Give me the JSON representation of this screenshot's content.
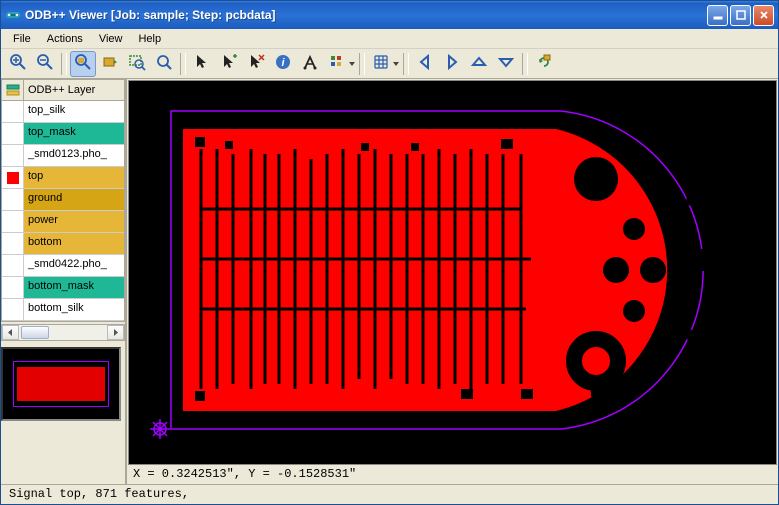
{
  "window": {
    "title": "ODB++ Viewer [Job: sample; Step: pcbdata]"
  },
  "menu": {
    "items": [
      "File",
      "Actions",
      "View",
      "Help"
    ]
  },
  "toolbar": {
    "groups": [
      [
        {
          "name": "zoom-in-icon",
          "tip": "Zoom In"
        },
        {
          "name": "zoom-out-icon",
          "tip": "Zoom Out"
        }
      ],
      [
        {
          "name": "zoom-home-icon",
          "tip": "Zoom Home",
          "active": true
        },
        {
          "name": "pan-icon",
          "tip": "Pan"
        },
        {
          "name": "zoom-area-icon",
          "tip": "Zoom Area"
        },
        {
          "name": "zoom-fit-icon",
          "tip": "Zoom to Profile"
        }
      ],
      [
        {
          "name": "pointer-icon",
          "tip": "Select"
        },
        {
          "name": "pointer-add-icon",
          "tip": "Highlight"
        },
        {
          "name": "pointer-cross-icon",
          "tip": "Unselect"
        },
        {
          "name": "info-icon",
          "tip": "Feature Info"
        },
        {
          "name": "measure-icon",
          "tip": "Measure"
        },
        {
          "name": "settings-icon",
          "tip": "Options",
          "drop": true
        }
      ],
      [
        {
          "name": "grid-icon",
          "tip": "Grid",
          "drop": true
        }
      ],
      [
        {
          "name": "arrow-left-icon",
          "tip": "Left"
        },
        {
          "name": "arrow-right-icon",
          "tip": "Right"
        },
        {
          "name": "arrow-up-icon",
          "tip": "Up"
        },
        {
          "name": "arrow-down-icon",
          "tip": "Down"
        }
      ],
      [
        {
          "name": "redraw-icon",
          "tip": "Redraw"
        }
      ]
    ]
  },
  "layers": {
    "header_label": "ODB++ Layer",
    "items": [
      {
        "name": "top_silk",
        "bg": "#ffffff",
        "swatch": null
      },
      {
        "name": "top_mask",
        "bg": "#1fb896",
        "swatch": null
      },
      {
        "name": "_smd0123.pho_",
        "bg": "#ffffff",
        "swatch": null
      },
      {
        "name": "top",
        "bg": "#e5b637",
        "swatch": "#ff0000",
        "selected": true
      },
      {
        "name": "ground",
        "bg": "#d6a516",
        "swatch": null
      },
      {
        "name": "power",
        "bg": "#e5b637",
        "swatch": null
      },
      {
        "name": "bottom",
        "bg": "#e5b637",
        "swatch": null
      },
      {
        "name": "_smd0422.pho_",
        "bg": "#ffffff",
        "swatch": null
      },
      {
        "name": "bottom_mask",
        "bg": "#1fb896",
        "swatch": null
      },
      {
        "name": "bottom_silk",
        "bg": "#ffffff",
        "swatch": null
      }
    ]
  },
  "coords": {
    "text": "X = 0.3242513\", Y = -0.1528531\""
  },
  "status": {
    "text": "Signal top, 871 features,"
  },
  "colors": {
    "pcb_fill": "#ff0000",
    "pcb_outline": "#a000ff",
    "origin": "#a000ff"
  }
}
